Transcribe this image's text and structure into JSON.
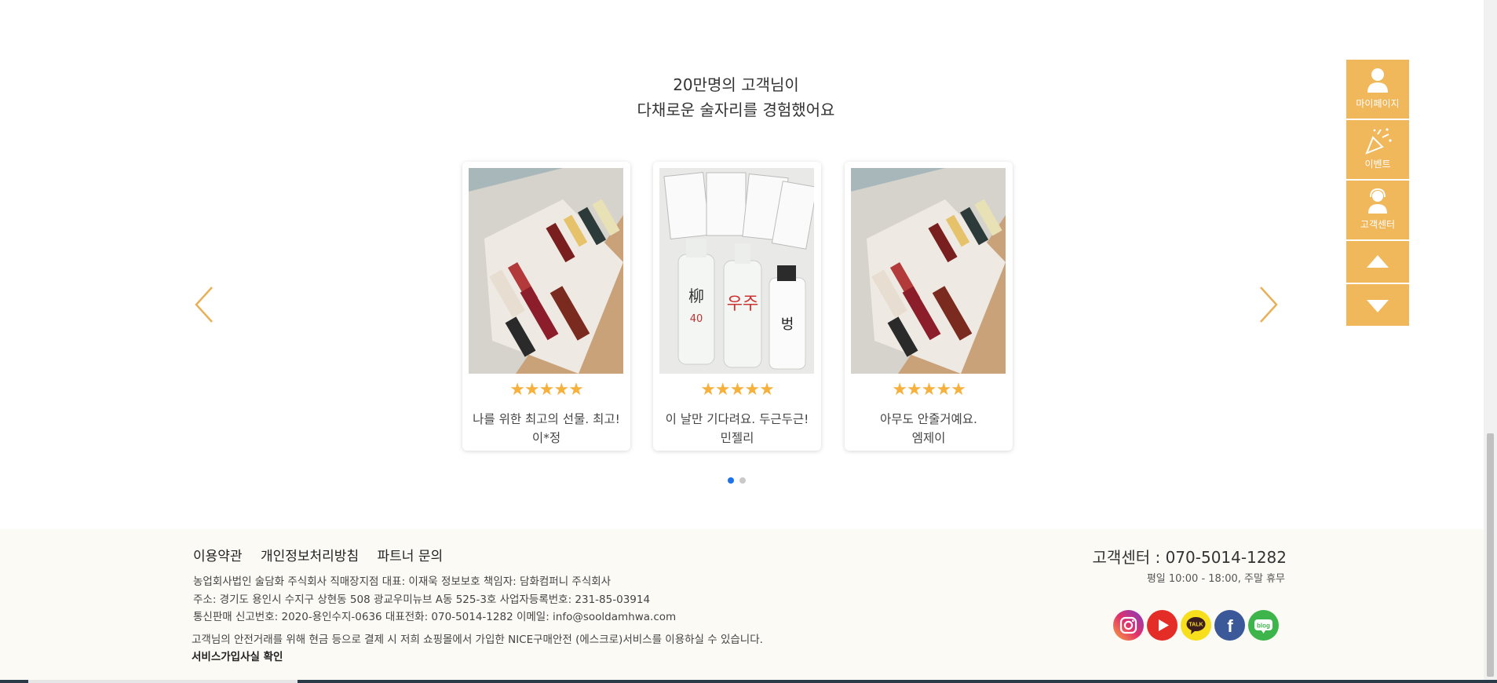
{
  "section": {
    "headline_line1": "20만명의 고객님이",
    "headline_line2": "다채로운 술자리를 경험했어요"
  },
  "reviews": [
    {
      "stars": "★★★★★",
      "rating": 5,
      "text": "나를 위한 최고의 선물. 최고!",
      "author": "이*정"
    },
    {
      "stars": "★★★★★",
      "rating": 5,
      "text": "이 날만 기다려요. 두근두근!",
      "author": "민젤리"
    },
    {
      "stars": "★★★★★",
      "rating": 5,
      "text": "아무도 안줄거예요.",
      "author": "엠제이"
    }
  ],
  "carousel": {
    "pages": 2,
    "active_page": 1
  },
  "side_menu": {
    "mypage_label": "마이페이지",
    "event_label": "이벤트",
    "cs_label": "고객센터"
  },
  "footer": {
    "links": [
      "이용약관",
      "개인정보처리방침",
      "파트너 문의"
    ],
    "company_line1": "농업회사법인 술담화 주식회사 직매장지점 대표: 이재욱 정보보호 책임자: 담화컴퍼니 주식회사",
    "company_line2": "주소: 경기도 용인시 수지구 상현동 508 광교우미뉴브 A동 525-3호 사업자등록번호: 231-85-03914",
    "company_line3": "통신판매 신고번호: 2020-용인수지-0636 대표전화: 070-5014-1282 이메일: info@sooldamhwa.com",
    "escrow_text": "고객님의 안전거래를 위해 현금 등으로 결제 시 저희 쇼핑몰에서 가입한 NICE구매안전 (에스크로)서비스를 이용하실 수 있습니다.",
    "escrow_link": "서비스가입사실 확인",
    "cs_phone": "고객센터 : 070-5014-1282",
    "cs_hours": "평일 10:00 - 18:00, 주말 휴무",
    "sns": {
      "kakao_label": "TALK",
      "blog_label": "blog",
      "facebook_label": "f"
    }
  },
  "colors": {
    "accent": "#f1b75b",
    "star": "#f6b13d",
    "arrow": "#e8b058",
    "dot_active": "#1a73e8",
    "footer_bg": "#fcfaf5"
  }
}
